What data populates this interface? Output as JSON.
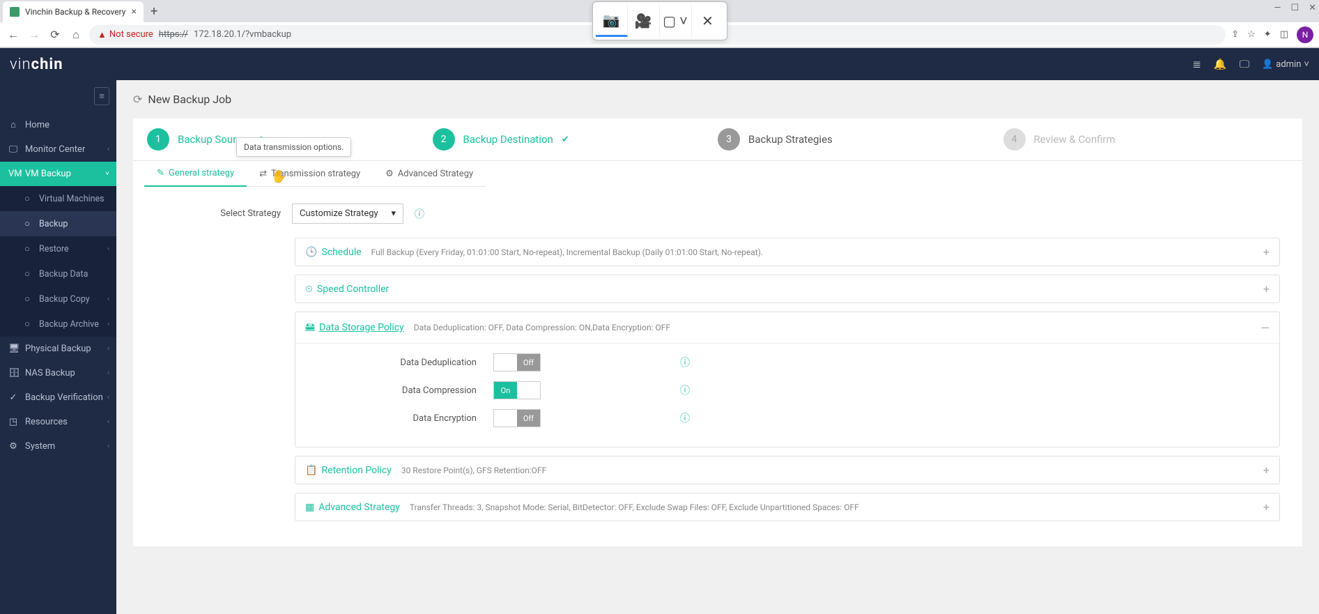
{
  "browser": {
    "tab_title": "Vinchin Backup & Recovery",
    "not_secure": "Not secure",
    "url_strike": "https://",
    "url": "172.18.20.1/?vmbackup",
    "avatar_initial": "N",
    "win_min": "—",
    "win_max": "☐",
    "win_close": "✕"
  },
  "header": {
    "logo_left": "vin",
    "logo_right": "chin",
    "user": "admin"
  },
  "sidebar": {
    "items": [
      {
        "label": "Home"
      },
      {
        "label": "Monitor Center"
      },
      {
        "label": "VM Backup"
      },
      {
        "label": "Physical Backup"
      },
      {
        "label": "NAS Backup"
      },
      {
        "label": "Backup Verification"
      },
      {
        "label": "Resources"
      },
      {
        "label": "System"
      }
    ],
    "sub": [
      {
        "label": "Virtual Machines"
      },
      {
        "label": "Backup"
      },
      {
        "label": "Restore"
      },
      {
        "label": "Backup Data"
      },
      {
        "label": "Backup Copy"
      },
      {
        "label": "Backup Archive"
      }
    ]
  },
  "page": {
    "title": "New Backup Job",
    "steps": [
      {
        "num": "1",
        "label": "Backup Source"
      },
      {
        "num": "2",
        "label": "Backup Destination"
      },
      {
        "num": "3",
        "label": "Backup Strategies"
      },
      {
        "num": "4",
        "label": "Review & Confirm"
      }
    ],
    "tooltip": "Data transmission options.",
    "tabs": [
      {
        "label": "General strategy"
      },
      {
        "label": "Transmission strategy"
      },
      {
        "label": "Advanced Strategy"
      }
    ],
    "select_label": "Select Strategy",
    "select_value": "Customize Strategy",
    "accordions": {
      "schedule": {
        "title": "Schedule",
        "desc": "Full Backup (Every Friday, 01:01:00 Start, No-repeat), Incremental Backup (Daily 01:01:00 Start, No-repeat)."
      },
      "speed": {
        "title": "Speed Controller"
      },
      "storage": {
        "title": "Data Storage Policy",
        "desc": "Data Deduplication: OFF, Data Compression: ON,Data Encryption: OFF",
        "opts": [
          {
            "label": "Data Deduplication",
            "on": false
          },
          {
            "label": "Data Compression",
            "on": true
          },
          {
            "label": "Data Encryption",
            "on": false
          }
        ],
        "on_text": "On",
        "off_text": "Off"
      },
      "retention": {
        "title": "Retention Policy",
        "desc": "30 Restore Point(s), GFS Retention:OFF"
      },
      "advanced": {
        "title": "Advanced Strategy",
        "desc": "Transfer Threads: 3, Snapshot Mode: Serial, BitDetector: OFF, Exclude Swap Files: OFF, Exclude Unpartitioned Spaces: OFF"
      }
    }
  }
}
